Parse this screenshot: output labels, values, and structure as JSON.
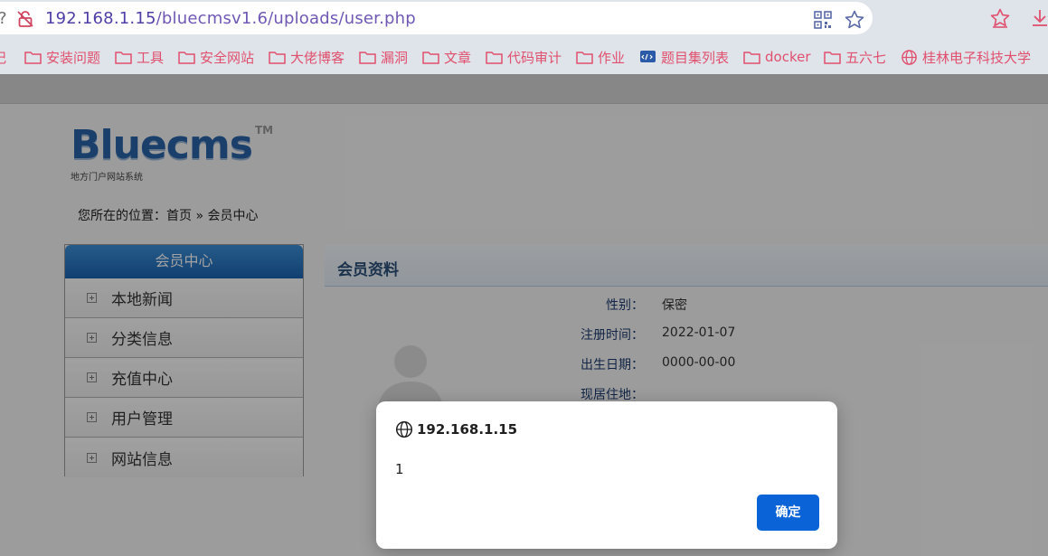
{
  "browser": {
    "url_host": "192.168.1.15",
    "url_path": "/bluecmsv1.6/uploads/user.php",
    "left_glyph": "?"
  },
  "bookmarks": [
    {
      "label": "记",
      "icon": "folder-icon"
    },
    {
      "label": "安装问题",
      "icon": "folder-icon"
    },
    {
      "label": "工具",
      "icon": "folder-icon"
    },
    {
      "label": "安全网站",
      "icon": "folder-icon"
    },
    {
      "label": "大佬博客",
      "icon": "folder-icon"
    },
    {
      "label": "漏洞",
      "icon": "folder-icon"
    },
    {
      "label": "文章",
      "icon": "folder-icon"
    },
    {
      "label": "代码审计",
      "icon": "folder-icon"
    },
    {
      "label": "作业",
      "icon": "folder-icon"
    },
    {
      "label": "题目集列表",
      "icon": "site-icon"
    },
    {
      "label": "docker",
      "icon": "folder-icon"
    },
    {
      "label": "五六七",
      "icon": "folder-icon"
    },
    {
      "label": "桂林电子科技大学",
      "icon": "globe-icon"
    }
  ],
  "site": {
    "logo_text": "Bluecms",
    "logo_tm": "TM",
    "logo_subtitle": "地方门户网站系统",
    "breadcrumb": "您所在的位置：首页 » 会员中心"
  },
  "sidebar": {
    "title": "会员中心",
    "items": [
      {
        "label": "本地新闻"
      },
      {
        "label": "分类信息"
      },
      {
        "label": "充值中心"
      },
      {
        "label": "用户管理"
      },
      {
        "label": "网站信息"
      }
    ]
  },
  "profile": {
    "title": "会员资料",
    "fields": [
      {
        "label": "性别：",
        "value": "保密"
      },
      {
        "label": "注册时间：",
        "value": "2022-01-07"
      },
      {
        "label": "出生日期：",
        "value": "0000-00-00"
      },
      {
        "label": "现居住地：",
        "value": ""
      }
    ]
  },
  "dialog": {
    "origin": "192.168.1.15",
    "message": "1",
    "ok_label": "确定"
  },
  "colors": {
    "accent": "#0b63d8",
    "bookmark_text": "#e0506e",
    "url_text": "#6f58b4"
  }
}
